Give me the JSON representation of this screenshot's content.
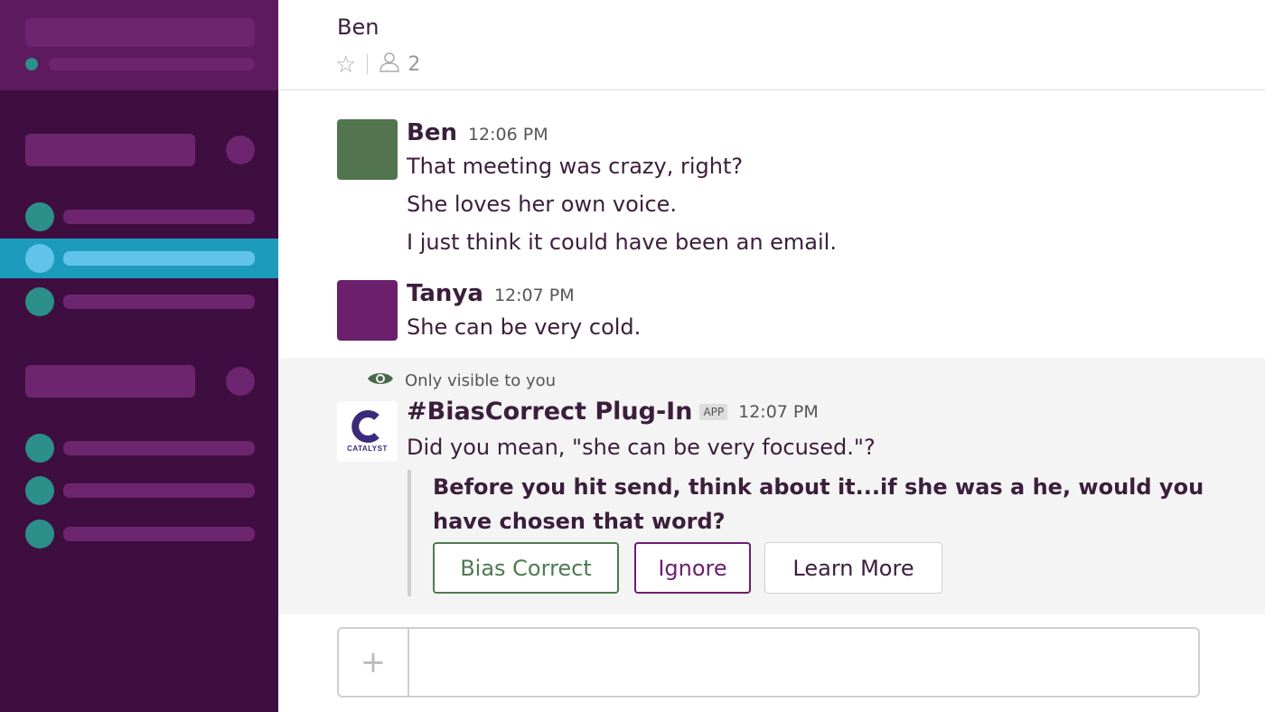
{
  "channel": {
    "name": "Ben",
    "member_count": "2"
  },
  "colors": {
    "sidebar_bg": "#3f0e40",
    "sidebar_header_bg": "#5d1a5f",
    "active_item": "#1d9bbc",
    "presence_teal": "#2c8f8a",
    "ben_avatar": "#527550",
    "tanya_avatar": "#6b1f6d"
  },
  "messages": [
    {
      "author": "Ben",
      "time": "12:06 PM",
      "lines": [
        "That meeting was crazy, right?",
        "She loves her own voice.",
        "I just think it could have been an email."
      ]
    },
    {
      "author": "Tanya",
      "time": "12:07 PM",
      "lines": [
        "She can be very cold."
      ]
    }
  ],
  "bot": {
    "visibility_note": "Only visible to you",
    "name": "#BiasCorrect Plug-In",
    "badge": "APP",
    "time": "12:07 PM",
    "logo_text": "CATALYST",
    "logo_letter": "C",
    "suggestion": "Did you mean, \"she can be very focused.\"?",
    "prompt": "Before you hit send, think about it...if she was a he, would you have chosen that word?",
    "buttons": {
      "correct": "Bias Correct",
      "ignore": "Ignore",
      "learn": "Learn More"
    }
  },
  "composer": {
    "placeholder": "",
    "plus": "+"
  },
  "icons": [
    "star-icon",
    "members-icon",
    "eye-icon",
    "plus-icon"
  ]
}
